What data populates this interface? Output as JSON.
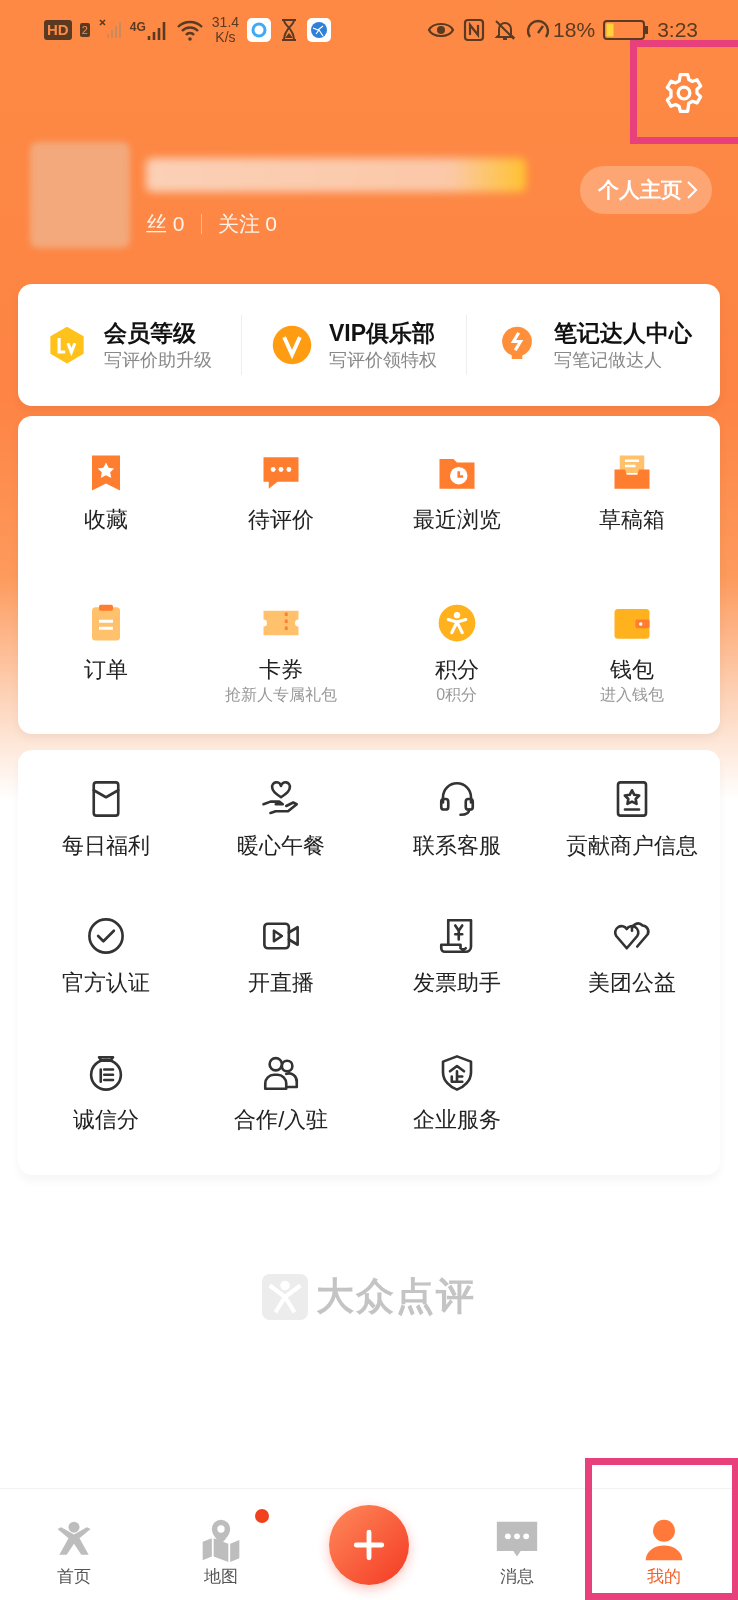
{
  "status_bar": {
    "hd": "HD",
    "sim": "2",
    "network": "4G",
    "speed_value": "31.4",
    "speed_unit": "K/s",
    "battery_text": "18%",
    "time": "3:23"
  },
  "header": {
    "settings_highlighted": true
  },
  "profile": {
    "stats": [
      "丝 0",
      "关注 0"
    ],
    "homepage_button": "个人主页"
  },
  "member_cards": [
    {
      "kind": "level",
      "title": "会员等级",
      "subtitle": "写评价助升级"
    },
    {
      "kind": "vip",
      "title": "VIP俱乐部",
      "subtitle": "写评价领特权"
    },
    {
      "kind": "bulb",
      "title": "笔记达人中心",
      "subtitle": "写笔记做达人"
    }
  ],
  "main_grid": [
    {
      "kind": "favorite",
      "label": "收藏"
    },
    {
      "kind": "review",
      "label": "待评价"
    },
    {
      "kind": "history",
      "label": "最近浏览"
    },
    {
      "kind": "drafts",
      "label": "草稿箱"
    },
    {
      "kind": "order",
      "label": "订单"
    },
    {
      "kind": "coupon",
      "label": "卡券",
      "subtitle": "抢新人专属礼包"
    },
    {
      "kind": "points",
      "label": "积分",
      "subtitle": "0积分"
    },
    {
      "kind": "wallet",
      "label": "钱包",
      "subtitle": "进入钱包"
    }
  ],
  "services": [
    {
      "kind": "gift",
      "label": "每日福利"
    },
    {
      "kind": "care",
      "label": "暖心午餐"
    },
    {
      "kind": "headset",
      "label": "联系客服"
    },
    {
      "kind": "shop",
      "label": "贡献商户信息"
    },
    {
      "kind": "verified",
      "label": "官方认证"
    },
    {
      "kind": "live",
      "label": "开直播"
    },
    {
      "kind": "invoice",
      "label": "发票助手"
    },
    {
      "kind": "charity",
      "label": "美团公益"
    },
    {
      "kind": "credit",
      "label": "诚信分"
    },
    {
      "kind": "partner",
      "label": "合作/入驻"
    },
    {
      "kind": "enterprise",
      "label": "企业服务"
    }
  ],
  "footer_brand": "大众点评",
  "bottom_nav": [
    {
      "kind": "home",
      "label": "首页",
      "selected": false
    },
    {
      "kind": "map",
      "label": "地图",
      "selected": false,
      "badge": true
    },
    {
      "kind": "add"
    },
    {
      "kind": "messages",
      "label": "消息",
      "selected": false
    },
    {
      "kind": "me",
      "label": "我的",
      "selected": true,
      "highlighted": true
    }
  ]
}
